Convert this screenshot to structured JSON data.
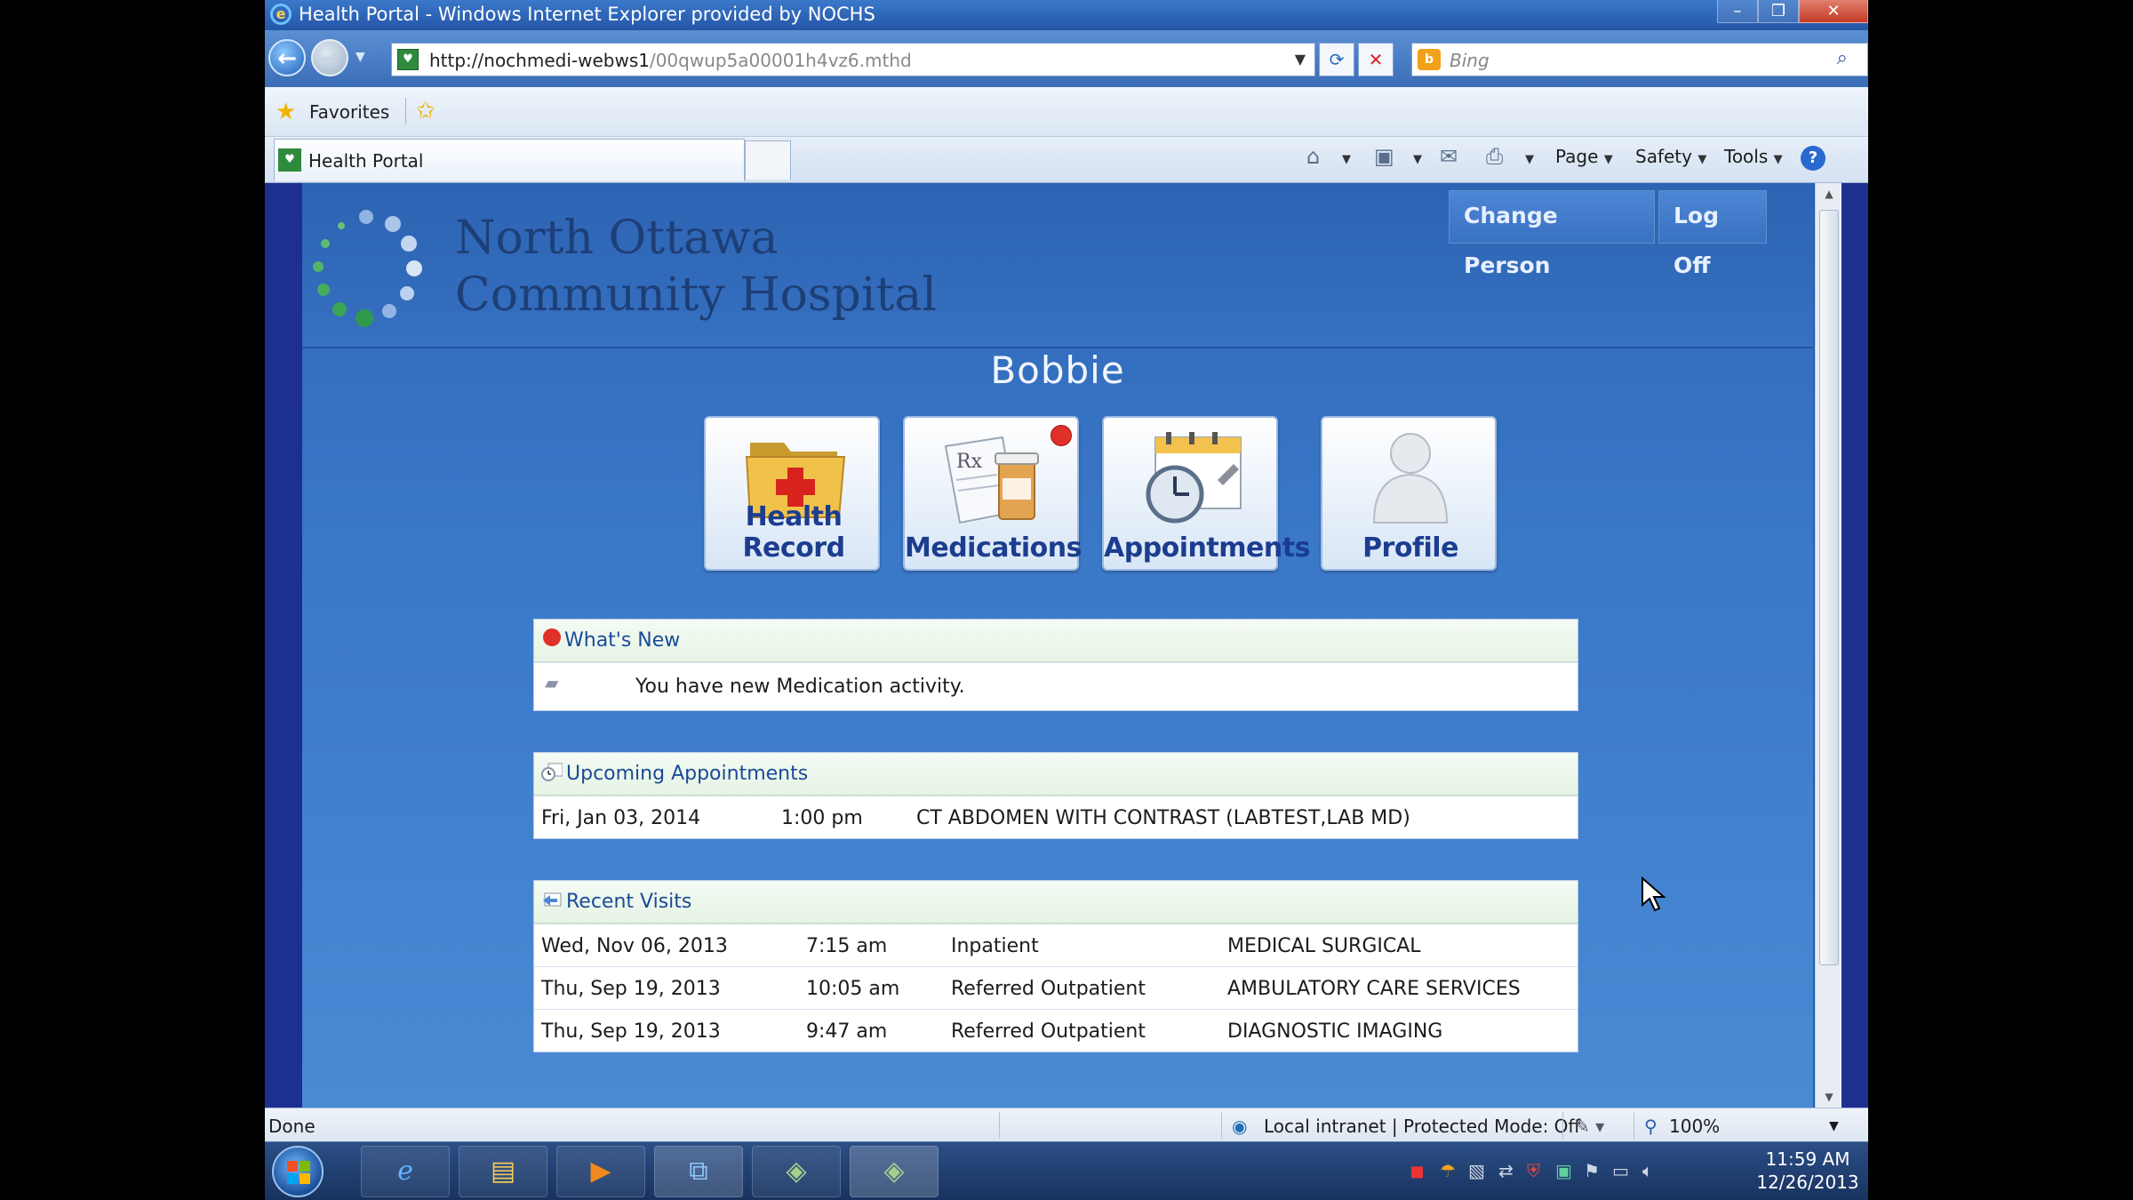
{
  "window": {
    "title": "Health Portal - Windows Internet Explorer provided by NOCHS",
    "min_icon": "minimize-icon",
    "max_icon": "restore-icon",
    "close_icon": "close-icon"
  },
  "addressbar": {
    "url_host": "http://nochmedi-webws1",
    "url_path": "/00qwup5a00001h4vz6.mthd",
    "search_placeholder": "Bing"
  },
  "favorites": {
    "label": "Favorites"
  },
  "tabs": [
    {
      "label": "Health Portal"
    }
  ],
  "commandbar": {
    "page": "Page",
    "safety": "Safety",
    "tools": "Tools",
    "help": "?"
  },
  "portal": {
    "hospital_line1": "North Ottawa",
    "hospital_line2": "Community Hospital",
    "change_person": "Change Person",
    "log_off": "Log Off",
    "person_name": "Bobbie",
    "tiles": [
      {
        "label": "Health Record",
        "icon": "folder-medical-cross-icon",
        "badge": false
      },
      {
        "label": "Medications",
        "icon": "prescription-bottle-icon",
        "badge": true
      },
      {
        "label": "Appointments",
        "icon": "calendar-clock-icon",
        "badge": false
      },
      {
        "label": "Profile",
        "icon": "person-icon",
        "badge": false
      }
    ],
    "whats_new": {
      "title": "What's New",
      "items": [
        {
          "text": "You have new Medication activity."
        }
      ]
    },
    "upcoming": {
      "title": "Upcoming Appointments",
      "rows": [
        {
          "date": "Fri, Jan 03, 2014",
          "time": "1:00 pm",
          "desc": "CT ABDOMEN WITH CONTRAST (LABTEST,LAB MD)"
        }
      ]
    },
    "recent": {
      "title": "Recent Visits",
      "rows": [
        {
          "date": "Wed, Nov 06, 2013",
          "time": "7:15 am",
          "type": "Inpatient",
          "dept": "MEDICAL SURGICAL"
        },
        {
          "date": "Thu, Sep 19, 2013",
          "time": "10:05 am",
          "type": "Referred Outpatient",
          "dept": "AMBULATORY CARE SERVICES"
        },
        {
          "date": "Thu, Sep 19, 2013",
          "time": "9:47 am",
          "type": "Referred Outpatient",
          "dept": "DIAGNOSTIC IMAGING"
        }
      ]
    }
  },
  "statusbar": {
    "status": "Done",
    "zone": "Local intranet | Protected Mode: Off",
    "zoom": "100%"
  },
  "taskbar": {
    "time": "11:59 AM",
    "date": "12/26/2013"
  },
  "colors": {
    "portal_blue": "#3a78c8",
    "hospital_text": "#1d3f77",
    "tile_label": "#1c3d8f",
    "panel_title": "#1a4a98",
    "alert_red": "#e0302a"
  }
}
